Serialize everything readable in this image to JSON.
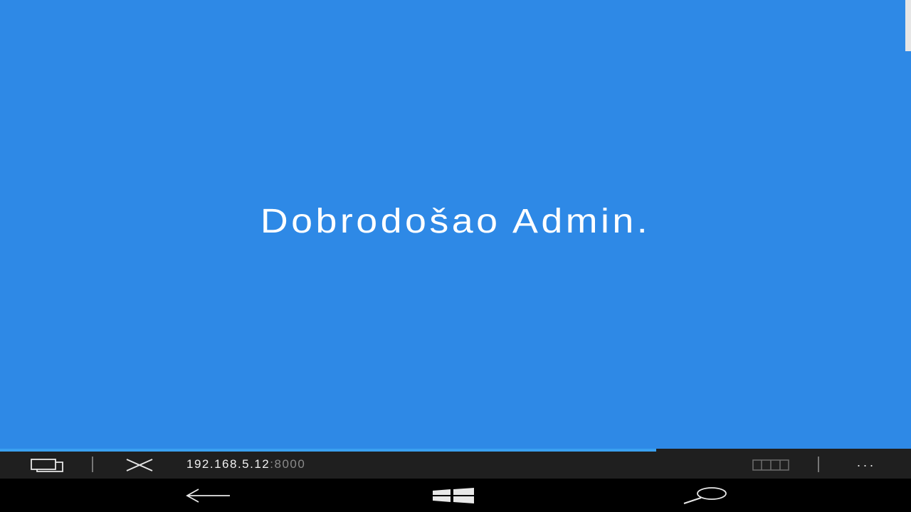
{
  "content": {
    "welcome_text": "Dobrodošao Admin.",
    "background_color": "#2e89e6"
  },
  "browser": {
    "load_progress": 0.72,
    "url_host": "192.168.5.12",
    "url_port": ":8000",
    "tabs_icon": "tabs-icon",
    "stop_icon": "close-icon",
    "reading_view_icon": "reading-view-icon",
    "more_icon": "more-icon",
    "more_label": "···"
  },
  "navigation": {
    "back_icon": "back-arrow-icon",
    "start_icon": "windows-start-icon",
    "search_icon": "search-icon"
  }
}
